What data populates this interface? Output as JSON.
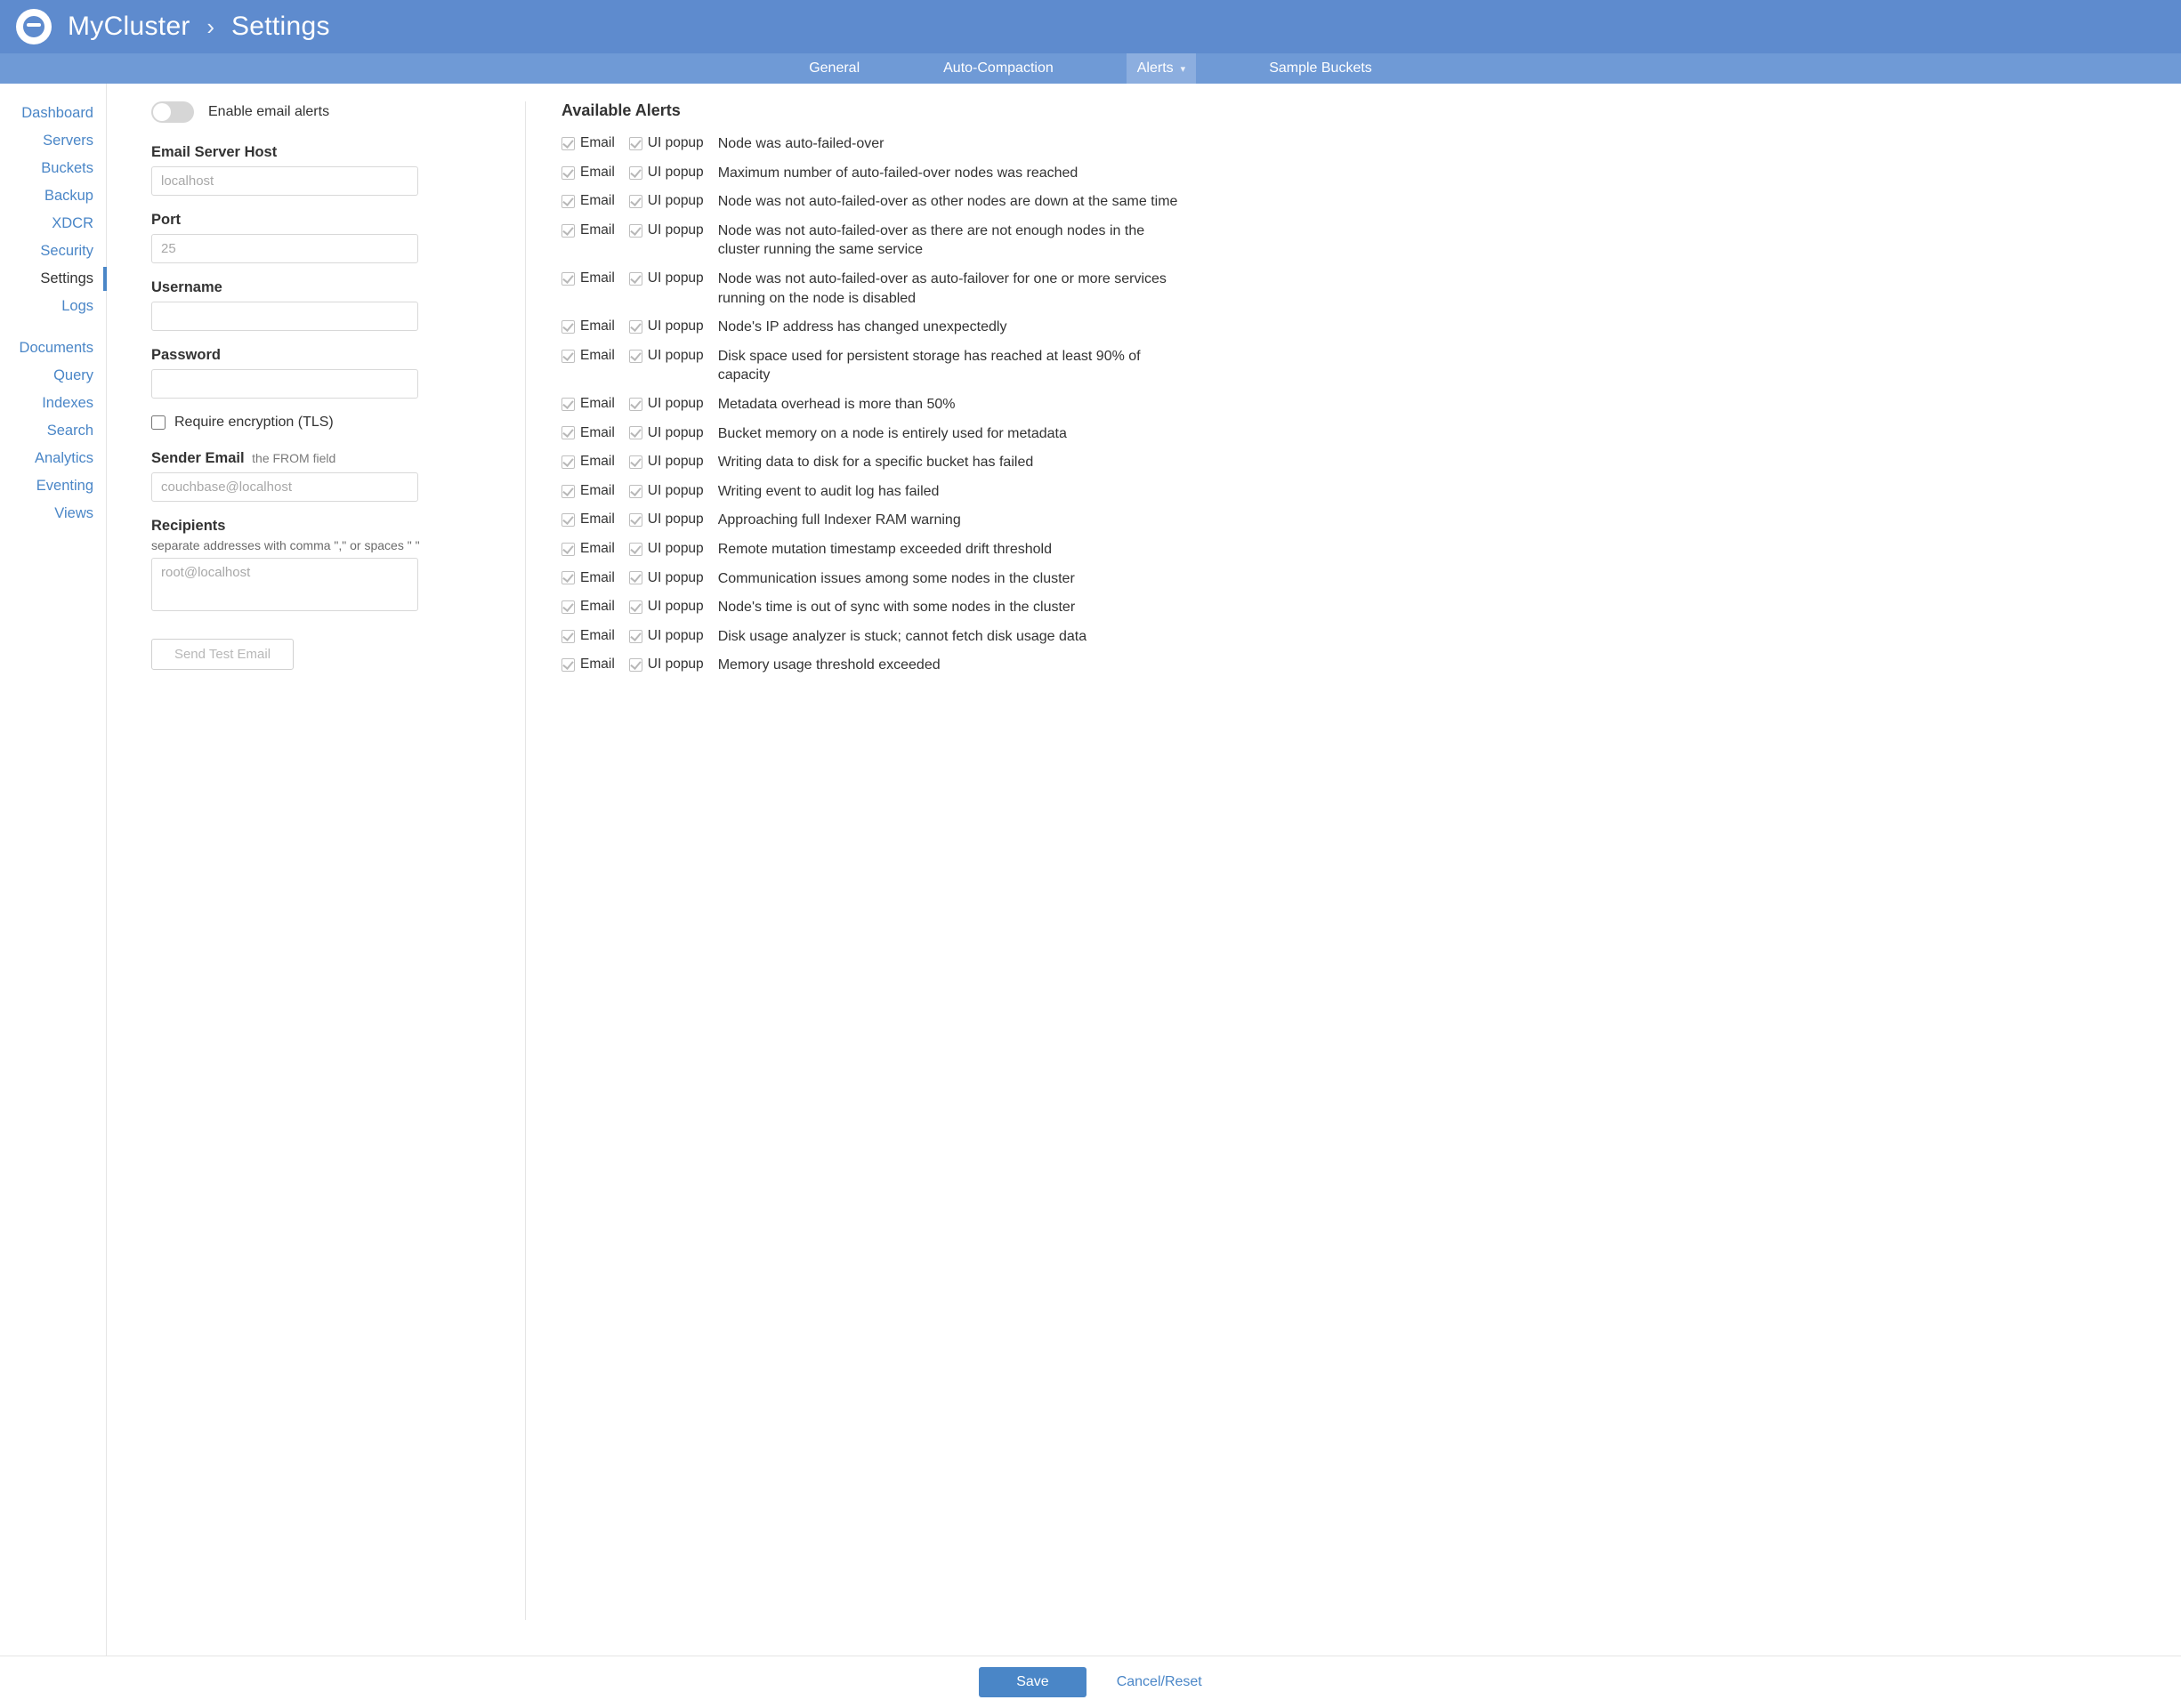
{
  "header": {
    "cluster_name": "MyCluster",
    "page_title": "Settings"
  },
  "subtabs": {
    "general": "General",
    "auto_compaction": "Auto-Compaction",
    "alerts": "Alerts",
    "sample_buckets": "Sample Buckets",
    "active": "alerts"
  },
  "sidebar": {
    "groups": [
      [
        "Dashboard",
        "Servers",
        "Buckets",
        "Backup",
        "XDCR",
        "Security",
        "Settings",
        "Logs"
      ],
      [
        "Documents",
        "Query",
        "Indexes",
        "Search",
        "Analytics",
        "Eventing",
        "Views"
      ]
    ],
    "active": "Settings"
  },
  "form": {
    "enable_label": "Enable email alerts",
    "enable_value": false,
    "host_label": "Email Server Host",
    "host_placeholder": "localhost",
    "host_value": "",
    "port_label": "Port",
    "port_placeholder": "25",
    "port_value": "",
    "username_label": "Username",
    "username_value": "",
    "password_label": "Password",
    "password_value": "",
    "tls_label": "Require encryption (TLS)",
    "tls_value": false,
    "sender_label": "Sender Email",
    "sender_sublabel": "the FROM field",
    "sender_placeholder": "couchbase@localhost",
    "sender_value": "",
    "recipients_label": "Recipients",
    "recipients_help": "separate addresses with comma \",\" or spaces \" \"",
    "recipients_placeholder": "root@localhost",
    "recipients_value": "",
    "send_test_label": "Send Test Email"
  },
  "alerts": {
    "title": "Available Alerts",
    "email_label": "Email",
    "popup_label": "UI popup",
    "items": [
      "Node was auto-failed-over",
      "Maximum number of auto-failed-over nodes was reached",
      "Node was not auto-failed-over as other nodes are down at the same time",
      "Node was not auto-failed-over as there are not enough nodes in the cluster running the same service",
      "Node was not auto-failed-over as auto-failover for one or more services running on the node is disabled",
      "Node's IP address has changed unexpectedly",
      "Disk space used for persistent storage has reached at least 90% of capacity",
      "Metadata overhead is more than 50%",
      "Bucket memory on a node is entirely used for metadata",
      "Writing data to disk for a specific bucket has failed",
      "Writing event to audit log has failed",
      "Approaching full Indexer RAM warning",
      "Remote mutation timestamp exceeded drift threshold",
      "Communication issues among some nodes in the cluster",
      "Node's time is out of sync with some nodes in the cluster",
      "Disk usage analyzer is stuck; cannot fetch disk usage data",
      "Memory usage threshold exceeded"
    ]
  },
  "footer": {
    "save": "Save",
    "cancel": "Cancel/Reset"
  }
}
